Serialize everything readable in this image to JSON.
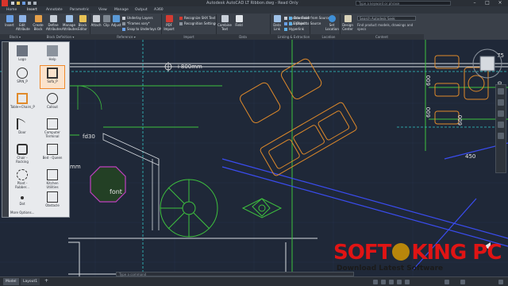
{
  "window": {
    "title": "Autodesk AutoCAD LT    Ribbon.dwg - Read Only",
    "search_placeholder": "Type a keyword or phrase",
    "controls": [
      "–",
      "□",
      "×"
    ]
  },
  "tabs": [
    "Home",
    "Insert",
    "Annotate",
    "Parametric",
    "View",
    "Manage",
    "Output",
    "A360"
  ],
  "active_tab": "Insert",
  "ribbon": {
    "block_buttons": [
      "Insert",
      "Edit Attribute"
    ],
    "define_buttons": [
      "Create Block",
      "Define Attributes",
      "Manage Attributes",
      "Block Editor"
    ],
    "reference_buttons": [
      "Attach",
      "Clip",
      "Adjust"
    ],
    "reference_small": [
      "Underlay Layers",
      "*Frames vary*",
      "Snap to Underlays ON"
    ],
    "import_buttons": [
      "PDF Import"
    ],
    "import_small": [
      "Recognize SHX Text",
      "Recognition Settings"
    ],
    "data_buttons": [
      "Combine Text",
      "Field"
    ],
    "data_small": [],
    "linking_buttons": [
      "Data Link"
    ],
    "linking_small": [
      "Update Fields",
      "OLE Object",
      "Hyperlink"
    ],
    "location_small": [
      "Download from Source",
      "Upload to Source"
    ],
    "location_buttons": [
      "Set Location"
    ],
    "content_buttons": [
      "Design Center"
    ],
    "content_search": "Search Autodesk Seek",
    "content_hint": "Find product models, drawings and specs",
    "panel_labels": [
      "Block ▾",
      "Block Definition ▾",
      "Reference ▾",
      "Import",
      "Data",
      "Linking & Extraction",
      "Location",
      "Content"
    ]
  },
  "palette": {
    "items": [
      "Logo",
      "Help",
      "SPIN_P",
      "Sofa_P",
      "Table+Chairs_P",
      "Callout",
      "Door",
      "Computer Terminal",
      "Chair - Rocking",
      "Bed - Queen",
      "Plant - Rubber...",
      "Kitchen Utilities",
      "Dot",
      "Obstacle"
    ],
    "selected": "Sofa_P",
    "more_options": "More Options..."
  },
  "drawing": {
    "dim_800": "+800mm",
    "label_font": "font",
    "label_fd30": "fd30",
    "label_mm": "mm",
    "dim_600a": "600",
    "dim_600b": "600",
    "dim_450": "450",
    "dim_1350": "1350",
    "dim_600c": "600",
    "dim_75": "75"
  },
  "status": {
    "tabs": [
      "Model",
      "Layout1"
    ],
    "command_placeholder": "Type a command"
  },
  "watermark": {
    "brand_left": "SOFT",
    "brand_right": "KING PC",
    "tagline": "Download Latest Software"
  },
  "colors": {
    "canvas_bg": "#1f2838",
    "ribbon_bg": "#3a4049",
    "accent_orange": "#f08a2c",
    "cad_orange": "#e08a2a",
    "cad_green": "#3ec23e",
    "cad_cyan": "#33c6c6",
    "cad_blue": "#3a4cf0",
    "cad_magenta": "#c040c0",
    "watermark_red": "#e01414"
  }
}
